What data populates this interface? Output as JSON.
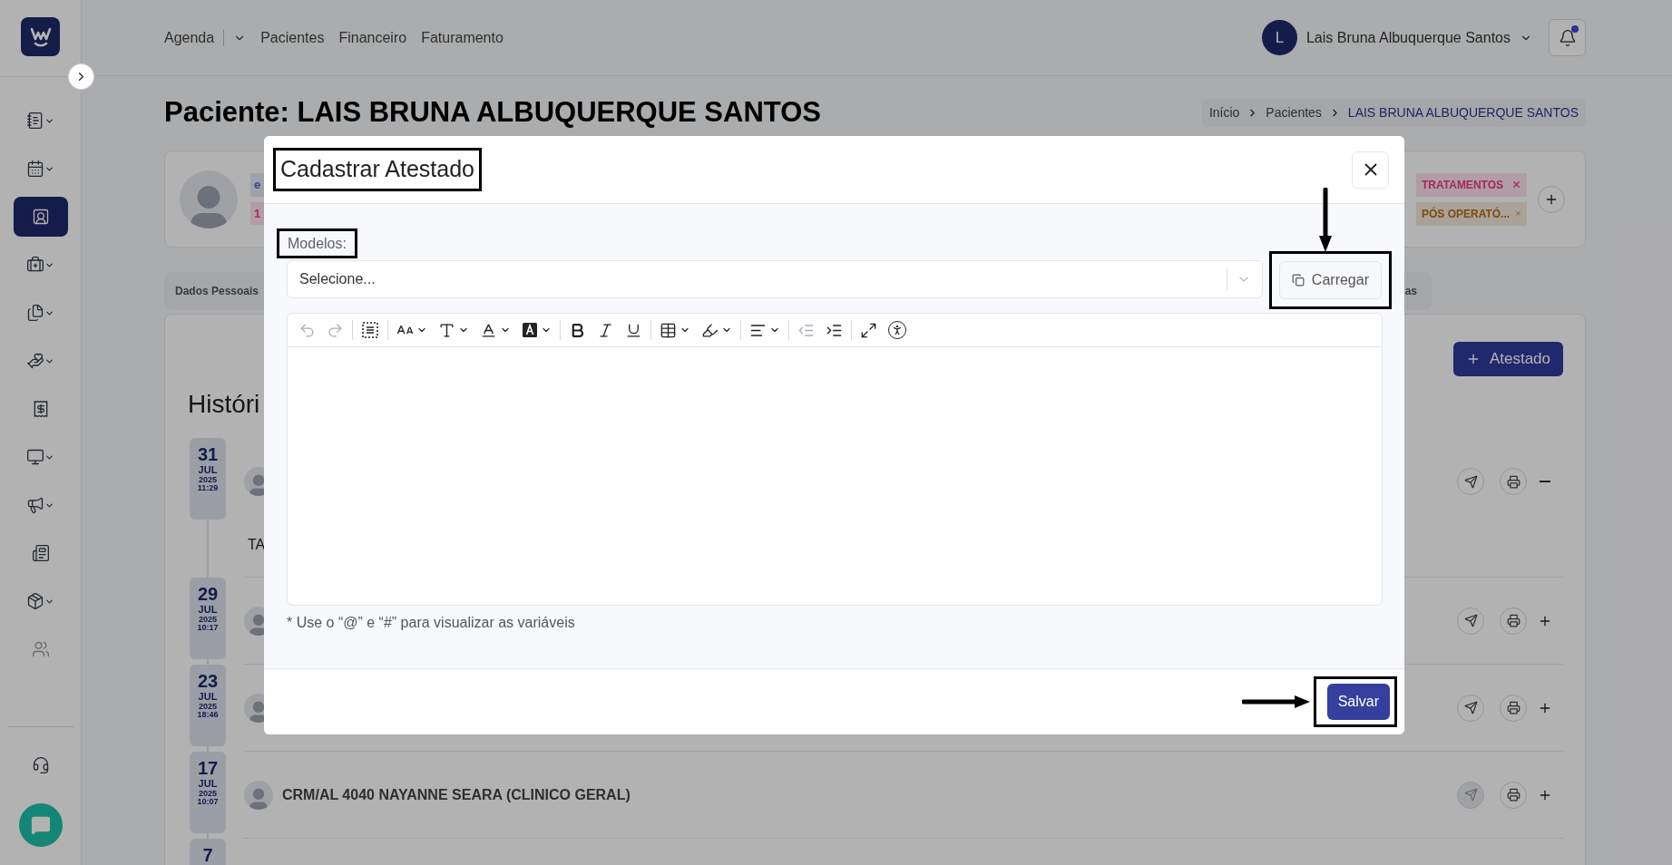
{
  "sidebar": {
    "items": [
      {
        "kind": "notebook",
        "dropdown": true,
        "selected": false,
        "muted": false
      },
      {
        "kind": "calendar",
        "dropdown": true,
        "selected": false,
        "muted": false
      },
      {
        "kind": "contact",
        "dropdown": false,
        "selected": true,
        "muted": false
      },
      {
        "kind": "medkit",
        "dropdown": true,
        "selected": false,
        "muted": false
      },
      {
        "kind": "files",
        "dropdown": true,
        "selected": false,
        "muted": false
      },
      {
        "kind": "hand",
        "dropdown": true,
        "selected": false,
        "muted": false
      },
      {
        "kind": "receipt",
        "dropdown": false,
        "selected": false,
        "muted": false
      },
      {
        "kind": "monitor",
        "dropdown": true,
        "selected": false,
        "muted": false
      },
      {
        "kind": "megaphone",
        "dropdown": true,
        "selected": false,
        "muted": false
      },
      {
        "kind": "newspaper",
        "dropdown": false,
        "selected": false,
        "muted": false
      },
      {
        "kind": "package",
        "dropdown": true,
        "selected": false,
        "muted": false
      },
      {
        "kind": "users",
        "dropdown": false,
        "selected": false,
        "muted": true
      }
    ],
    "bottom": [
      {
        "kind": "headset",
        "dropdown": false,
        "selected": false,
        "muted": false
      }
    ]
  },
  "topnav": {
    "items": [
      {
        "label": "Agenda",
        "dropdown": true
      },
      {
        "label": "Pacientes",
        "dropdown": false
      },
      {
        "label": "Financeiro",
        "dropdown": false
      },
      {
        "label": "Faturamento",
        "dropdown": false
      }
    ],
    "user": {
      "initial": "L",
      "name": "Lais Bruna Albuquerque Santos"
    },
    "notifications": {
      "unread": true
    }
  },
  "page": {
    "title": "Paciente: LAIS BRUNA ALBUQUERQUE SANTOS",
    "breadcrumb": [
      {
        "label": "Início",
        "current": false
      },
      {
        "label": "Pacientes",
        "current": false
      },
      {
        "label": "LAIS BRUNA ALBUQUERQUE SANTOS",
        "current": true
      }
    ]
  },
  "patient_card": {
    "tags_left": [
      {
        "label": "e",
        "color": "#39428a"
      },
      {
        "label": "1",
        "color": "#a8285e"
      }
    ],
    "tags_right": [
      {
        "label": "TRATAMENTOS",
        "color": "#a8285e"
      },
      {
        "label": "PÓS OPERATÓ...",
        "color": "#7c4a10"
      }
    ]
  },
  "tabs": [
    {
      "label": "Dados Pessoais"
    },
    {
      "label": "as"
    }
  ],
  "history": {
    "title": "Históri",
    "add_button": "Atestado",
    "entries": [
      {
        "day": "31",
        "month": "JUL",
        "year": "2025",
        "time": "11:29",
        "expanded": true,
        "body": "TA",
        "send_disabled": false
      },
      {
        "day": "29",
        "month": "JUL",
        "year": "2025",
        "time": "10:17",
        "expanded": false,
        "send_disabled": false
      },
      {
        "day": "23",
        "month": "JUL",
        "year": "2025",
        "time": "18:46",
        "expanded": false,
        "send_disabled": false
      },
      {
        "day": "17",
        "month": "JUL",
        "year": "2025",
        "time": "10:07",
        "expanded": false,
        "doctor": "CRM/AL 4040 NAYANNE SEARA (CLINICO GERAL)",
        "send_disabled": true
      },
      {
        "day": "7"
      }
    ]
  },
  "modal": {
    "title": {
      "text": "Cadastrar Atestado",
      "framed": true
    },
    "models_label": {
      "text": "Modelos:",
      "framed": true
    },
    "select_placeholder": "Selecione...",
    "load_button": {
      "label": "Carregar",
      "framed": true,
      "pointer": true
    },
    "toolbar": [
      [
        {
          "kind": "undo",
          "dropdown": false,
          "disabled": true
        },
        {
          "kind": "redo",
          "dropdown": false,
          "disabled": true
        }
      ],
      [
        {
          "kind": "select-all",
          "dropdown": false,
          "disabled": false
        }
      ],
      [
        {
          "kind": "font-size",
          "dropdown": true,
          "disabled": false
        },
        {
          "kind": "font-format",
          "dropdown": true,
          "disabled": false
        },
        {
          "kind": "font-color",
          "dropdown": true,
          "disabled": false
        },
        {
          "kind": "background-color",
          "dropdown": true,
          "disabled": false
        }
      ],
      [
        {
          "kind": "bold",
          "dropdown": false,
          "disabled": false
        },
        {
          "kind": "italic",
          "dropdown": false,
          "disabled": false
        },
        {
          "kind": "underline",
          "dropdown": false,
          "disabled": false
        }
      ],
      [
        {
          "kind": "table",
          "dropdown": true,
          "disabled": false
        },
        {
          "kind": "highlight",
          "dropdown": true,
          "disabled": false
        }
      ],
      [
        {
          "kind": "align",
          "dropdown": true,
          "disabled": false
        }
      ],
      [
        {
          "kind": "outdent",
          "dropdown": false,
          "disabled": true
        },
        {
          "kind": "indent",
          "dropdown": false,
          "disabled": false
        }
      ],
      [
        {
          "kind": "fullscreen",
          "dropdown": false,
          "disabled": false
        },
        {
          "kind": "accessibility",
          "dropdown": false,
          "disabled": false
        }
      ]
    ],
    "hint": "* Use o “@” e “#” para visualizar as variáveis",
    "save_button": {
      "label": "Salvar",
      "framed": true,
      "pointer": true
    }
  }
}
